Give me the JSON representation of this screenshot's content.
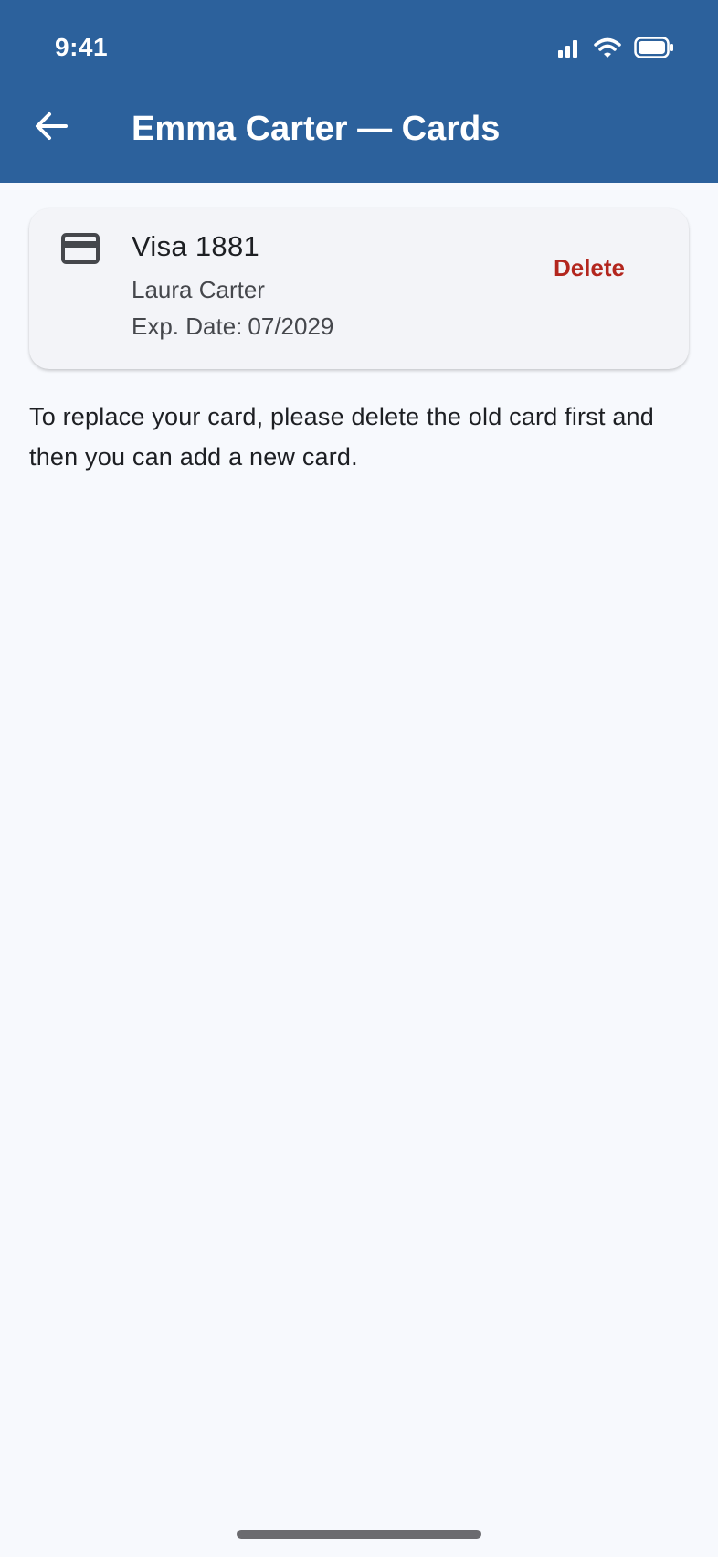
{
  "status_bar": {
    "time": "9:41",
    "icons": [
      "signal-icon",
      "wifi-icon",
      "battery-icon"
    ]
  },
  "header": {
    "title": "Emma Carter — Cards",
    "back_icon": "arrow-left-icon"
  },
  "card": {
    "icon": "credit-card-icon",
    "title": "Visa 1881",
    "holder": "Laura Carter",
    "expiry_label": "Exp. Date:",
    "expiry_value": "07/2029",
    "delete_label": "Delete"
  },
  "info": {
    "text": "To replace your card, please delete the old card first and then you can add a new card."
  },
  "colors": {
    "app_bar": "#2c619c",
    "background": "#f7f9fd",
    "card_background": "#f3f4f8",
    "delete_text": "#b3261e"
  }
}
